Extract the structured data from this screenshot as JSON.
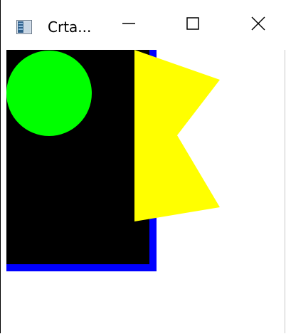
{
  "window": {
    "title": "Crta...",
    "icon": "app-window-icon",
    "controls": {
      "minimize_icon": "minimize-icon",
      "maximize_icon": "maximize-icon",
      "close_icon": "close-icon"
    }
  },
  "drawing": {
    "colors": {
      "background": "#000000",
      "border": "#0000ff",
      "circle": "#00ff00",
      "flag": "#ffff00"
    }
  }
}
